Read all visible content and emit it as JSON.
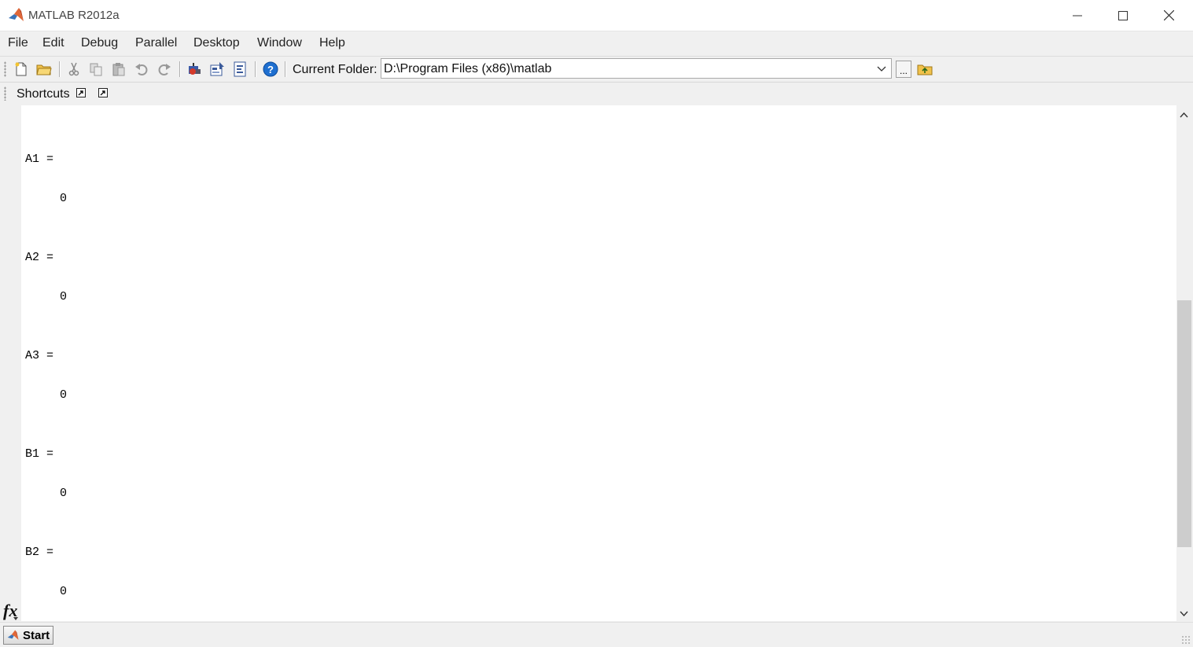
{
  "window": {
    "title": "MATLAB  R2012a",
    "brand_color": "#e16737"
  },
  "menu": {
    "items": [
      "File",
      "Edit",
      "Debug",
      "Parallel",
      "Desktop",
      "Window",
      "Help"
    ]
  },
  "toolbar": {
    "icons": [
      "new-file-icon",
      "open-folder-icon",
      "cut-icon",
      "copy-icon",
      "paste-icon",
      "undo-icon",
      "redo-icon",
      "simulink-icon",
      "guide-icon",
      "profiler-icon",
      "help-icon"
    ],
    "current_folder_label": "Current Folder:",
    "current_folder_value": "D:\\Program Files (x86)\\matlab",
    "browse_label": "..."
  },
  "shortcuts": {
    "label": "Shortcuts"
  },
  "command_window": {
    "entries": [
      {
        "name": "A1 =",
        "value": "0"
      },
      {
        "name": "A2 =",
        "value": "0"
      },
      {
        "name": "A3 =",
        "value": "0"
      },
      {
        "name": "B1 =",
        "value": "0"
      },
      {
        "name": "B2 =",
        "value": "0"
      }
    ],
    "fx_label": "fx"
  },
  "status": {
    "start_label": "Start"
  }
}
